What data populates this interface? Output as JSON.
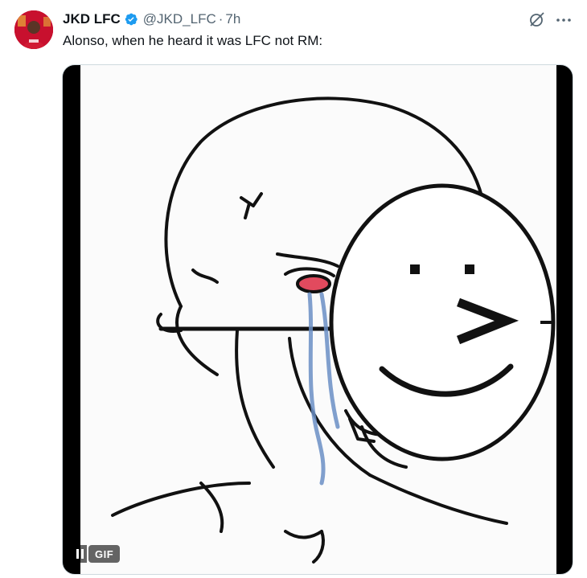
{
  "tweet": {
    "author": {
      "display_name": "JKD LFC",
      "handle": "@JKD_LFC",
      "verified": true,
      "avatar_icon": "profile-photo"
    },
    "separator": "·",
    "time": "7h",
    "text": "Alonso, when he heard it was LFC not RM:",
    "media": {
      "type": "GIF",
      "badge_label": "GIF",
      "drawn_text": ": >"
    }
  },
  "icons": {
    "grok": "grok-icon",
    "more": "more-icon",
    "verified": "verified-badge-icon",
    "pause": "pause-icon"
  },
  "colors": {
    "text": "#0f1419",
    "secondary": "#536471",
    "verified": "#1d9bf0",
    "avatar_bg": "#c8102e"
  }
}
